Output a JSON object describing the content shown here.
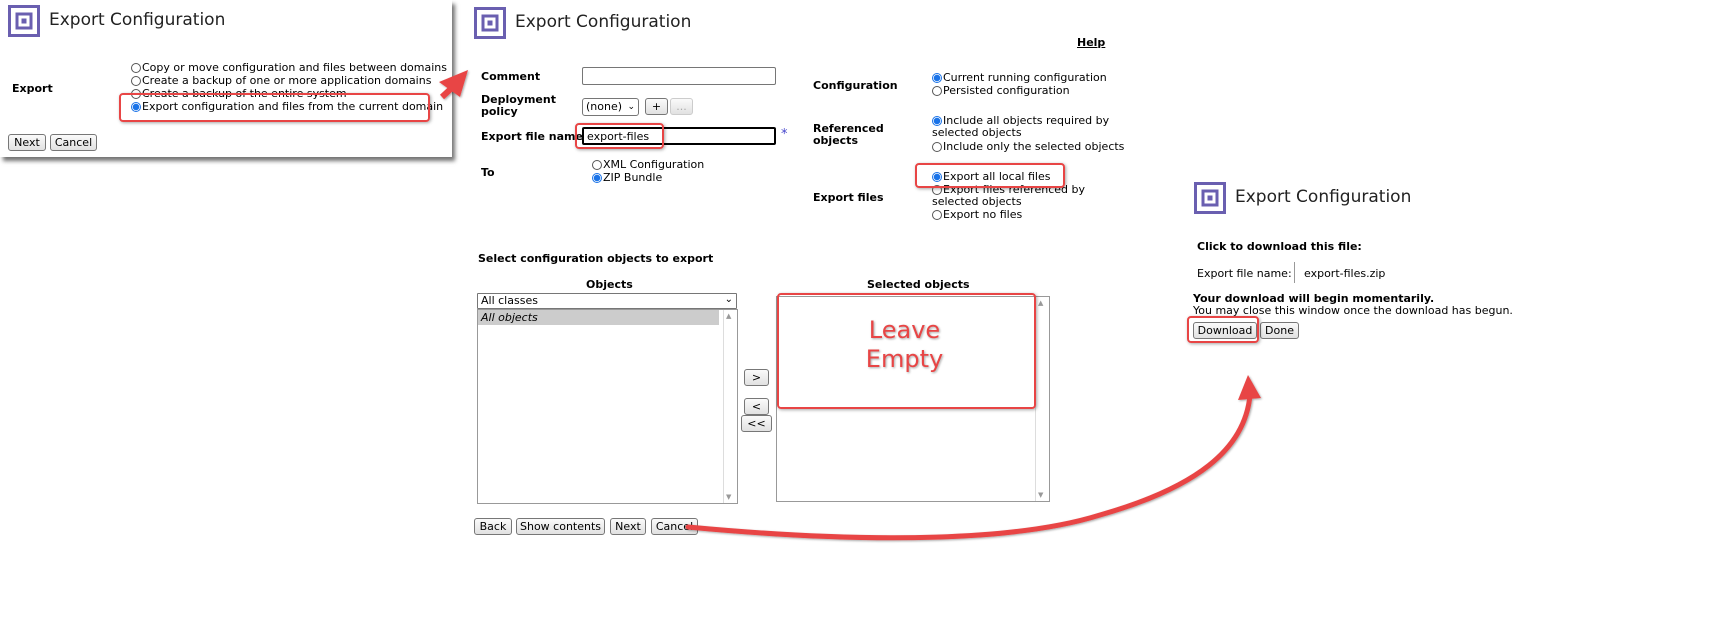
{
  "panel1": {
    "title": "Export Configuration",
    "export_label": "Export",
    "options": [
      "Copy or move configuration and files between domains",
      "Create a backup of one or more application domains",
      "Create a backup of the entire system",
      "Export configuration and files from the current domain"
    ],
    "selected_index": 3,
    "next_label": "Next",
    "cancel_label": "Cancel"
  },
  "panel2": {
    "title": "Export Configuration",
    "help_label": "Help",
    "comment_label": "Comment",
    "comment_value": "",
    "deployment_policy_label": "Deployment policy",
    "deployment_policy_value": "(none)",
    "add_label": "+",
    "more_label": "...",
    "export_file_name_label": "Export file name",
    "export_file_name_value": "export-files",
    "required_mark": "*",
    "to_label": "To",
    "to_options": [
      "XML Configuration",
      "ZIP Bundle"
    ],
    "to_selected": 1,
    "configuration_label": "Configuration",
    "configuration_options": [
      "Current running configuration",
      "Persisted configuration"
    ],
    "configuration_selected": 0,
    "referenced_objects_label": "Referenced objects",
    "referenced_options": [
      "Include all objects required by selected objects",
      "Include only the selected objects"
    ],
    "referenced_selected": 0,
    "export_files_label": "Export files",
    "export_files_options": [
      "Export all local files",
      "Export files referenced by selected objects",
      "Export no files"
    ],
    "export_files_selected": 0,
    "select_heading": "Select configuration objects to export",
    "objects_heading": "Objects",
    "selected_heading": "Selected objects",
    "class_filter_value": "All classes",
    "objects_list": [
      "All objects"
    ],
    "move_right_label": ">",
    "move_left_label": "<",
    "move_all_left_label": "<<",
    "back_label": "Back",
    "show_contents_label": "Show contents",
    "next_label": "Next",
    "cancel_label": "Cancel"
  },
  "annotation": {
    "leave_empty": "Leave Empty"
  },
  "panel3": {
    "title": "Export Configuration",
    "click_to_download": "Click to download this file:",
    "file_name_label": "Export file name:",
    "file_name_value": "export-files.zip",
    "download_begin": "Your download will begin momentarily.",
    "may_close": "You may close this window once the download has begun.",
    "download_label": "Download",
    "done_label": "Done"
  },
  "colors": {
    "accent": "#6a5fb0",
    "highlight": "#e84545",
    "radio_selected": "#1a73e8"
  }
}
